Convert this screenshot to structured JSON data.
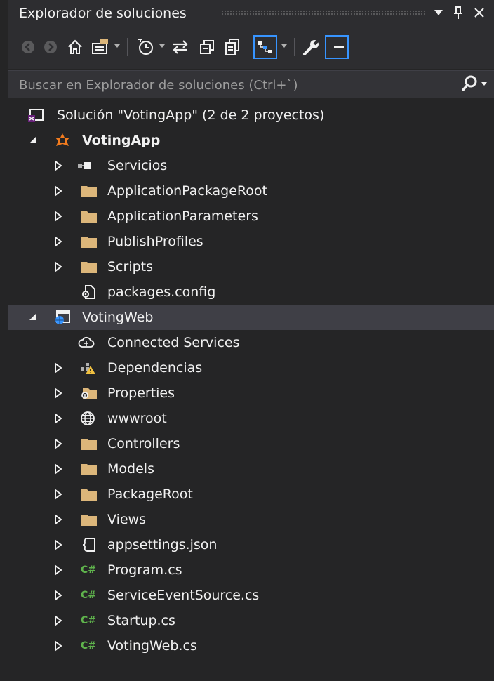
{
  "panel": {
    "title": "Explorador de soluciones",
    "pin_glyph": "4",
    "close_glyph": "×"
  },
  "search": {
    "placeholder": "Buscar en Explorador de soluciones (Ctrl+`)"
  },
  "toolbar": {
    "buttons": [
      "back-icon",
      "forward-icon",
      "home-icon",
      "switch-views-icon",
      "pending-changes-icon",
      "sync-icon",
      "collapse-all-icon",
      "show-all-files-icon",
      "preview-selected-icon",
      "properties-icon",
      "dock-icon"
    ]
  },
  "tree": {
    "solution": "Solución \"VotingApp\" (2 de 2 proyectos)",
    "votingapp": "VotingApp",
    "servicios": "Servicios",
    "app_package_root": "ApplicationPackageRoot",
    "app_parameters": "ApplicationParameters",
    "publish_profiles": "PublishProfiles",
    "scripts": "Scripts",
    "packages_config": "packages.config",
    "votingweb": "VotingWeb",
    "connected_services": "Connected Services",
    "dependencias": "Dependencias",
    "properties": "Properties",
    "wwwroot": "wwwroot",
    "controllers": "Controllers",
    "models": "Models",
    "package_root": "PackageRoot",
    "views": "Views",
    "appsettings": "appsettings.json",
    "program": "Program.cs",
    "service_event_source": "ServiceEventSource.cs",
    "startup": "Startup.cs",
    "votingweb_cs": "VotingWeb.cs",
    "cs_badge": "C#"
  },
  "colors": {
    "background": "#252526",
    "toolbar": "#2d2d30",
    "selected_row": "#3f3f46",
    "folder": "#dcb67a",
    "accent_blue": "#3794ff",
    "csharp_green": "#5fb34c",
    "service_fabric_orange": "#f27b1e"
  }
}
